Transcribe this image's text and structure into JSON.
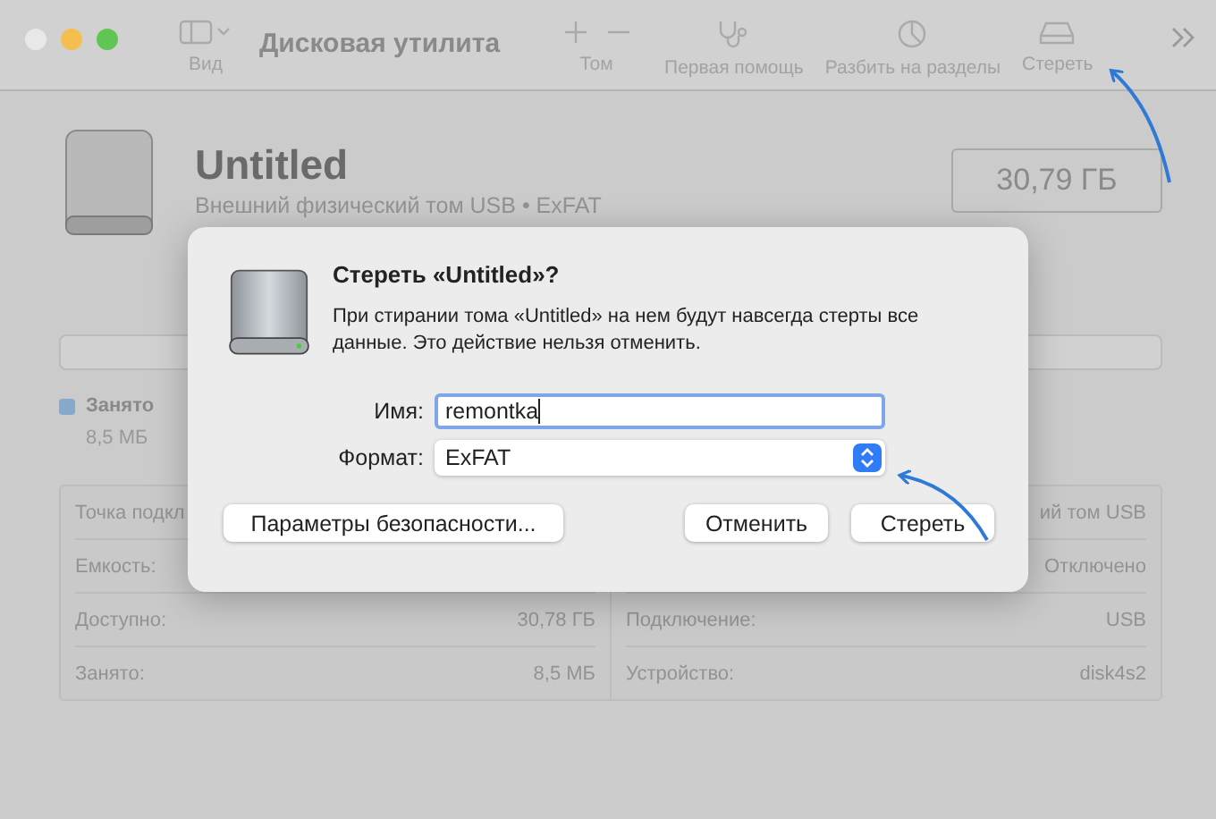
{
  "window": {
    "title": "Дисковая утилита"
  },
  "toolbar": [
    {
      "label": "Вид"
    },
    {
      "label": "Том"
    },
    {
      "label": "Первая помощь"
    },
    {
      "label": "Разбить на разделы"
    },
    {
      "label": "Стереть"
    }
  ],
  "volume": {
    "name": "Untitled",
    "subtitle": "Внешний физический том USB • ExFAT",
    "size": "30,79 ГБ"
  },
  "legend": [
    {
      "label": "Занято",
      "value": "8,5 МБ",
      "color": "#86a9cc"
    }
  ],
  "info_left": [
    {
      "label": "Точка подкл"
    },
    {
      "label": "Емкость:"
    },
    {
      "label": "Доступно:",
      "value": "30,78 ГБ"
    },
    {
      "label": "Занято:",
      "value": "8,5 МБ"
    }
  ],
  "info_right": [
    {
      "value": "ий том USB"
    },
    {
      "value": "Отключено"
    },
    {
      "label": "Подключение:",
      "value": "USB"
    },
    {
      "label": "Устройство:",
      "value": "disk4s2"
    }
  ],
  "dialog": {
    "title": "Стереть «Untitled»?",
    "message": "При стирании тома «Untitled» на нем будут навсегда стерты все данные. Это действие нельзя отменить.",
    "name_label": "Имя:",
    "name_value": "remontka",
    "format_label": "Формат:",
    "format_value": "ExFAT",
    "buttons": [
      "Параметры безопасности...",
      "Отменить",
      "Стереть"
    ]
  }
}
